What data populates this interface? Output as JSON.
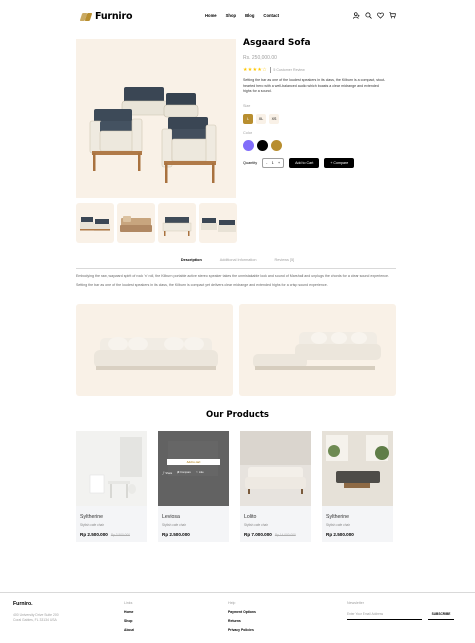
{
  "brand": {
    "name": "Furniro",
    "color": "#B88E2F"
  },
  "nav": [
    "Home",
    "Shop",
    "Blog",
    "Contact"
  ],
  "header_icons": [
    "user-icon",
    "search-icon",
    "heart-icon",
    "cart-icon"
  ],
  "product": {
    "title": "Asgaard Sofa",
    "price": "Rs. 250,000.00",
    "stars": "★★★★☆",
    "reviews": "5 Customer Review",
    "description": "Setting the bar as one of the loudest speakers in its class, the Kilburn is a compact, stout-hearted hero with a well-balanced audio which boasts a clear midrange and extended highs for a sound.",
    "size_label": "Size",
    "sizes": [
      "L",
      "XL",
      "XS"
    ],
    "selected_size": "L",
    "color_label": "Color",
    "colors": [
      "#816DFA",
      "#000000",
      "#B88E2F"
    ],
    "quantity_label": "Quantity",
    "quantity": "1",
    "minus": "-",
    "plus": "+",
    "add_to_cart": "Add to Cart",
    "compare": "+ Compare"
  },
  "tabs": {
    "items": [
      "Description",
      "Additional Information",
      "Reviews [5]"
    ],
    "active": "Description"
  },
  "description_paragraphs": [
    "Embodying the raw, wayward spirit of rock 'n' roll, the Kilburn portable active stereo speaker takes the unmistakable look and sound of Marshall and unplugs the chords for a clear sound experience.",
    "Setting the bar as one of the loudest speakers in its class, the Kilburn is compact yet delivers clear midrange and extended highs for a crisp sound experience."
  ],
  "products_section": {
    "title": "Our Products",
    "items": [
      {
        "name": "Syltherine",
        "sub": "Stylish cafe chair",
        "price": "Rp 2.500.000",
        "old_price": "Rp 3.500.000"
      },
      {
        "name": "Leviosa",
        "sub": "Stylish cafe chair",
        "price": "Rp 2.500.000",
        "old_price": ""
      },
      {
        "name": "Lolito",
        "sub": "Stylish cafe chair",
        "price": "Rp 7.000.000",
        "old_price": "Rp 14.000.000"
      },
      {
        "name": "Syltherine",
        "sub": "Stylish cafe chair",
        "price": "Rp 2.500.000",
        "old_price": ""
      }
    ],
    "hover": {
      "add_to_cart": "Add to cart",
      "share": "Share",
      "compare": "Compare",
      "like": "Like"
    }
  },
  "footer": {
    "brand": "Furniro.",
    "address_line1": "400 University Drive Suite 200",
    "address_line2": "Coral Gables, FL 33134 USA",
    "links_heading": "Links",
    "links": [
      "Home",
      "Shop",
      "About"
    ],
    "help_heading": "Help",
    "help": [
      "Payment Options",
      "Returns",
      "Privacy Policies"
    ],
    "newsletter_heading": "Newsletter",
    "newsletter_placeholder": "Enter Your Email Address",
    "subscribe": "SUBSCRIBE"
  }
}
